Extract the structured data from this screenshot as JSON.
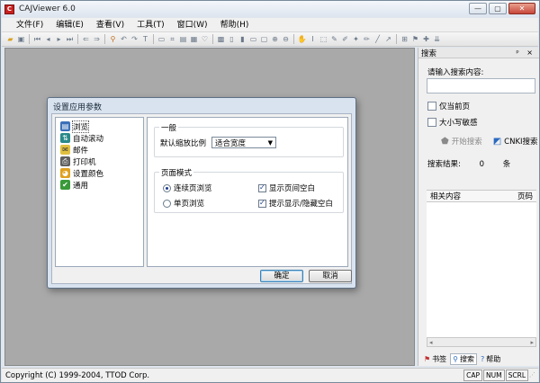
{
  "window": {
    "title": "CAJViewer 6.0",
    "min": "—",
    "max": "▢",
    "close": "✕"
  },
  "menu": [
    "文件(F)",
    "编辑(E)",
    "查看(V)",
    "工具(T)",
    "窗口(W)",
    "帮助(H)"
  ],
  "panel": {
    "title": "搜索",
    "pin": "ᵖ ×",
    "prompt": "请输入搜索内容:",
    "only_current_page": "仅当前页",
    "case_sensitive": "大小写敏感",
    "start_search": "开始搜索",
    "cnki_search": "CNKI搜索",
    "results_label": "搜索结果:",
    "results_count": "0",
    "results_unit": "条",
    "col_content": "相关内容",
    "col_page": "页码",
    "tabs": [
      "书签",
      "搜索",
      "帮助"
    ]
  },
  "statusbar": {
    "copyright": "Copyright (C) 1999-2004, TTOD Corp.",
    "indicators": [
      "CAP",
      "NUM",
      "SCRL"
    ]
  },
  "dialog": {
    "title": "设置应用参数",
    "tree": [
      {
        "label": "浏览",
        "icon": "browse-icon"
      },
      {
        "label": "自动滚动",
        "icon": "autoscroll-icon"
      },
      {
        "label": "邮件",
        "icon": "mail-icon"
      },
      {
        "label": "打印机",
        "icon": "printer-icon"
      },
      {
        "label": "设置颜色",
        "icon": "palette-icon"
      },
      {
        "label": "通用",
        "icon": "general-icon"
      }
    ],
    "general_group": "一般",
    "zoom_label": "默认缩放比例",
    "zoom_value": "适合宽度",
    "page_mode_group": "页面模式",
    "continuous": "连续页浏览",
    "single": "单页浏览",
    "show_blank": "显示页间空白",
    "toggle_blank": "提示显示/隐藏空白",
    "ok": "确定",
    "cancel": "取消"
  }
}
